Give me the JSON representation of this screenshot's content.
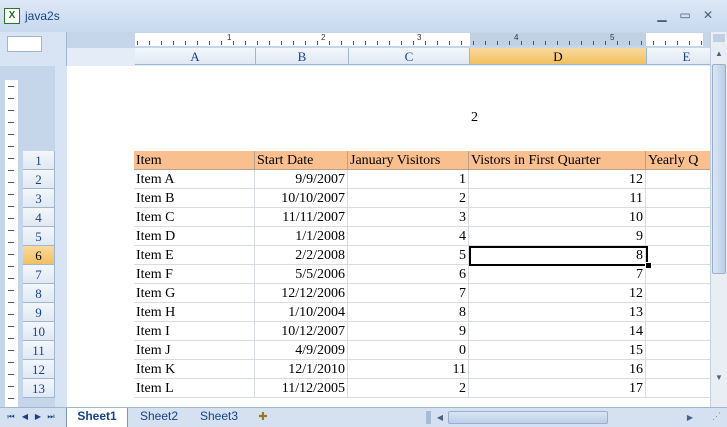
{
  "window": {
    "title": "java2s",
    "app_icon": "excel-icon",
    "minimize": "▁",
    "maximize": "▭",
    "close": "✕"
  },
  "ruler": {
    "numbers": [
      "1",
      "2",
      "3",
      "4",
      "5"
    ]
  },
  "columns": [
    "A",
    "B",
    "C",
    "D",
    "E"
  ],
  "selected_column": "D",
  "rows": [
    "1",
    "2",
    "3",
    "4",
    "5",
    "6",
    "7",
    "8",
    "9",
    "10",
    "11",
    "12",
    "13"
  ],
  "selected_row": "6",
  "page_number": "2",
  "sheet": {
    "headers": [
      "Item",
      "Start Date",
      "January Visitors",
      "Vistors in First Quarter",
      "Yearly Q"
    ],
    "data": [
      [
        "Item A",
        "9/9/2007",
        "1",
        "12"
      ],
      [
        "Item B",
        "10/10/2007",
        "2",
        "11"
      ],
      [
        "Item C",
        "11/11/2007",
        "3",
        "10"
      ],
      [
        "Item D",
        "1/1/2008",
        "4",
        "9"
      ],
      [
        "Item E",
        "2/2/2008",
        "5",
        "8"
      ],
      [
        "Item F",
        "5/5/2006",
        "6",
        "7"
      ],
      [
        "Item G",
        "12/12/2006",
        "7",
        "12"
      ],
      [
        "Item H",
        "1/10/2004",
        "8",
        "13"
      ],
      [
        "Item I",
        "10/12/2007",
        "9",
        "14"
      ],
      [
        "Item J",
        "4/9/2009",
        "0",
        "15"
      ],
      [
        "Item K",
        "12/1/2010",
        "11",
        "16"
      ],
      [
        "Item L",
        "11/12/2005",
        "2",
        "17"
      ]
    ]
  },
  "tabs": [
    "Sheet1",
    "Sheet2",
    "Sheet3"
  ],
  "active_tab": "Sheet1",
  "colors": {
    "header_fill": "#fabf8f",
    "selected_header": "#f1c15f",
    "accent": "#15428b"
  }
}
